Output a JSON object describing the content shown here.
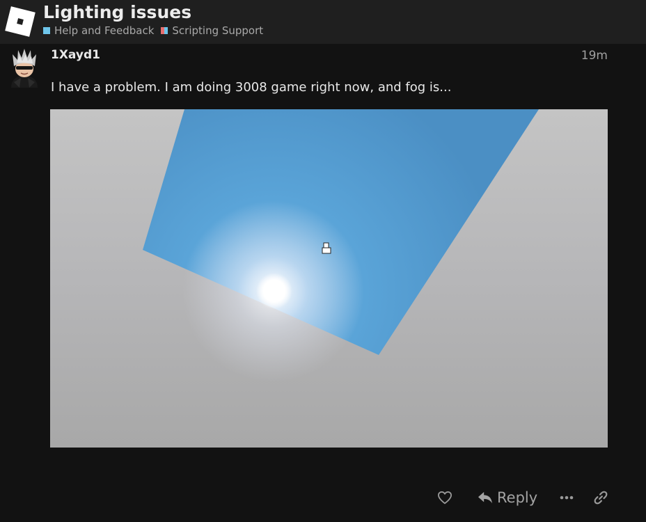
{
  "header": {
    "title": "Lighting issues",
    "categories": [
      {
        "label": "Help and Feedback",
        "color": "#6ec5ea"
      },
      {
        "label": "Scripting Support",
        "colors": [
          "#e86f6f",
          "#6ec5ea"
        ]
      }
    ]
  },
  "post": {
    "username": "1Xayd1",
    "time": "19m",
    "text": "I have a problem. I am doing 3008 game right now, and fog is..."
  },
  "actions": {
    "reply_label": "Reply"
  },
  "icons": {
    "logo": "roblox-logo",
    "like": "heart-icon",
    "reply": "reply-arrow-icon",
    "more": "ellipsis-icon",
    "link": "link-icon"
  },
  "colors": {
    "header_bg": "#1f1f1f",
    "page_bg": "#121212",
    "sky_blue": "#4d97cf",
    "fog_grey": "#b0b0b0"
  }
}
